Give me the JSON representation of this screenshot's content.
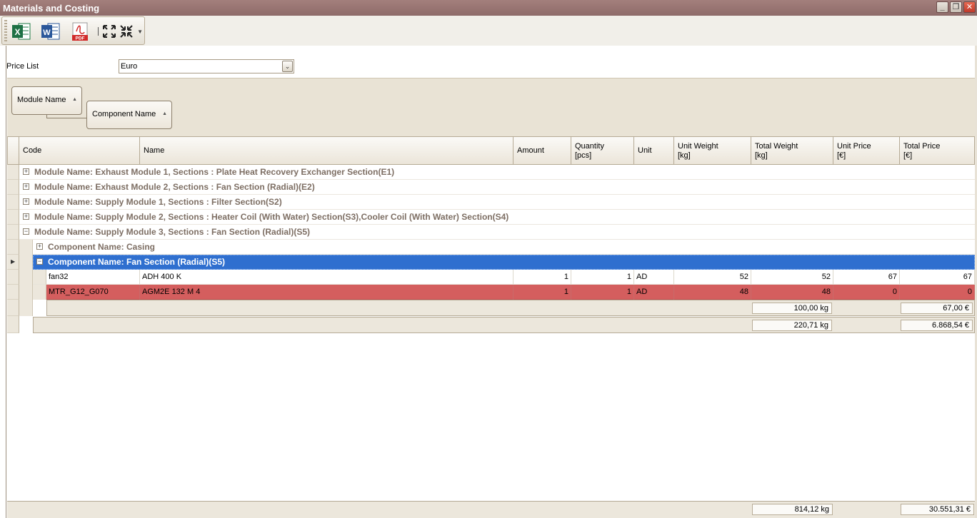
{
  "window": {
    "title": "Materials and Costing",
    "buttons": [
      "_",
      "❐",
      "✕"
    ]
  },
  "toolbar": {
    "icons": [
      "excel-export-icon",
      "word-export-icon",
      "pdf-export-icon",
      "expand-all-icon",
      "collapse-all-icon"
    ],
    "excel_letter": "X",
    "word_letter": "W",
    "pdf_label": "PDF",
    "more": "▼"
  },
  "price_list": {
    "label": "Price List",
    "value": "Euro",
    "arrow": "⌄"
  },
  "group_panel": {
    "chips": [
      "Module Name",
      "Component Name"
    ],
    "sort_glyph": "▲"
  },
  "grid": {
    "columns": [
      {
        "label": "Code"
      },
      {
        "label": "Name"
      },
      {
        "label": "Amount"
      },
      {
        "label": "Quantity\n[pcs]"
      },
      {
        "label": "Unit"
      },
      {
        "label": "Unit Weight\n[kg]"
      },
      {
        "label": "Total Weight\n[kg]"
      },
      {
        "label": "Unit Price\n[€]"
      },
      {
        "label": "Total Price\n[€]"
      }
    ],
    "module_groups": [
      {
        "text": "Module Name: Exhaust Module 1, Sections : Plate Heat Recovery Exchanger Section(E1)",
        "expanded": false
      },
      {
        "text": "Module Name: Exhaust Module 2, Sections : Fan Section (Radial)(E2)",
        "expanded": false
      },
      {
        "text": "Module Name: Supply Module 1, Sections : Filter Section(S2)",
        "expanded": false
      },
      {
        "text": "Module Name: Supply Module 2, Sections : Heater Coil (With Water) Section(S3),Cooler Coil (With Water) Section(S4)",
        "expanded": false
      },
      {
        "text": "Module Name: Supply Module 3, Sections : Fan Section (Radial)(S5)",
        "expanded": true
      }
    ],
    "component_groups": [
      {
        "text": "Component Name: Casing",
        "expanded": false
      },
      {
        "text": "Component Name: Fan Section (Radial)(S5)",
        "expanded": true,
        "selected": true
      }
    ],
    "rows": [
      {
        "code": "fan32",
        "name": "ADH 400 K",
        "amount": "1",
        "quantity": "1",
        "unit": "AD",
        "unit_weight": "52",
        "total_weight": "52",
        "unit_price": "67",
        "total_price": "67",
        "highlight": false
      },
      {
        "code": "MTR_G12_G070",
        "name": "AGM2E 132 M 4",
        "amount": "1",
        "quantity": "1",
        "unit": "AD",
        "unit_weight": "48",
        "total_weight": "48",
        "unit_price": "0",
        "total_price": "0",
        "highlight": true
      }
    ],
    "component_summary": {
      "total_weight": "100,00 kg",
      "total_price": "67,00 €"
    },
    "module_summary": {
      "total_weight": "220,71 kg",
      "total_price": "6.868,54 €"
    },
    "grand_total": {
      "total_weight": "814,12 kg",
      "total_price": "30.551,31 €"
    },
    "expander_plus": "+",
    "expander_minus": "−",
    "row_indicator": "▶"
  },
  "colors": {
    "titlebar": "#8e6b69",
    "selection": "#2f6fcf",
    "error_row": "#d45e5e"
  }
}
